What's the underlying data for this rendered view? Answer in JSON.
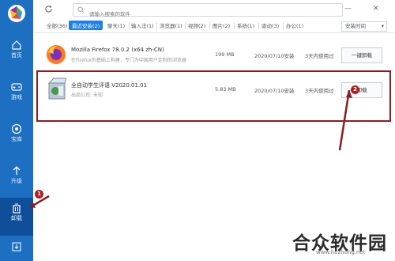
{
  "sidebar": {
    "items": [
      {
        "label": "首页",
        "icon": "home-icon"
      },
      {
        "label": "游戏",
        "icon": "gamepad-icon"
      },
      {
        "label": "宝库",
        "icon": "treasure-icon"
      },
      {
        "label": "升级",
        "icon": "upgrade-icon"
      },
      {
        "label": "卸载",
        "icon": "trash-icon"
      },
      {
        "label": "",
        "icon": "download-icon"
      }
    ]
  },
  "search": {
    "placeholder": "请输入搜索的软件"
  },
  "window": {
    "minimize": "—",
    "close": "✕"
  },
  "tabs": [
    "全部(36)",
    "最近安装(2)",
    "聊天(1)",
    "输入法(1)",
    "浏览器(1)",
    "视频(2)",
    "图片(2)",
    "系统(1)",
    "驱动(3)",
    "办公(1)"
  ],
  "sort_label": "安装时间",
  "apps": [
    {
      "name": "Mozilla Firefox 78.0.2 (x64 zh-CN)",
      "desc": "在Firefox的基础上构建，专门为中国用户定制的浏览器",
      "size": "199 MB",
      "date": "2020/07/10安装",
      "used": "3天内使用过",
      "action": "一键卸载"
    },
    {
      "name": "全自动学生评语 V2020.01.01",
      "desc": "出品公司: 未知",
      "size": "5.83 MB",
      "date": "2020/07/10安装",
      "used": "3天内使用过",
      "action": "卸载"
    }
  ],
  "markers": [
    "1",
    "2"
  ],
  "watermark": {
    "text": "合众软件园",
    "url": "www.hezhong.net"
  },
  "colors": {
    "sidebar": "#1d6fc2",
    "accent": "#1e7fe6",
    "highlight": "#8a1e1e"
  }
}
